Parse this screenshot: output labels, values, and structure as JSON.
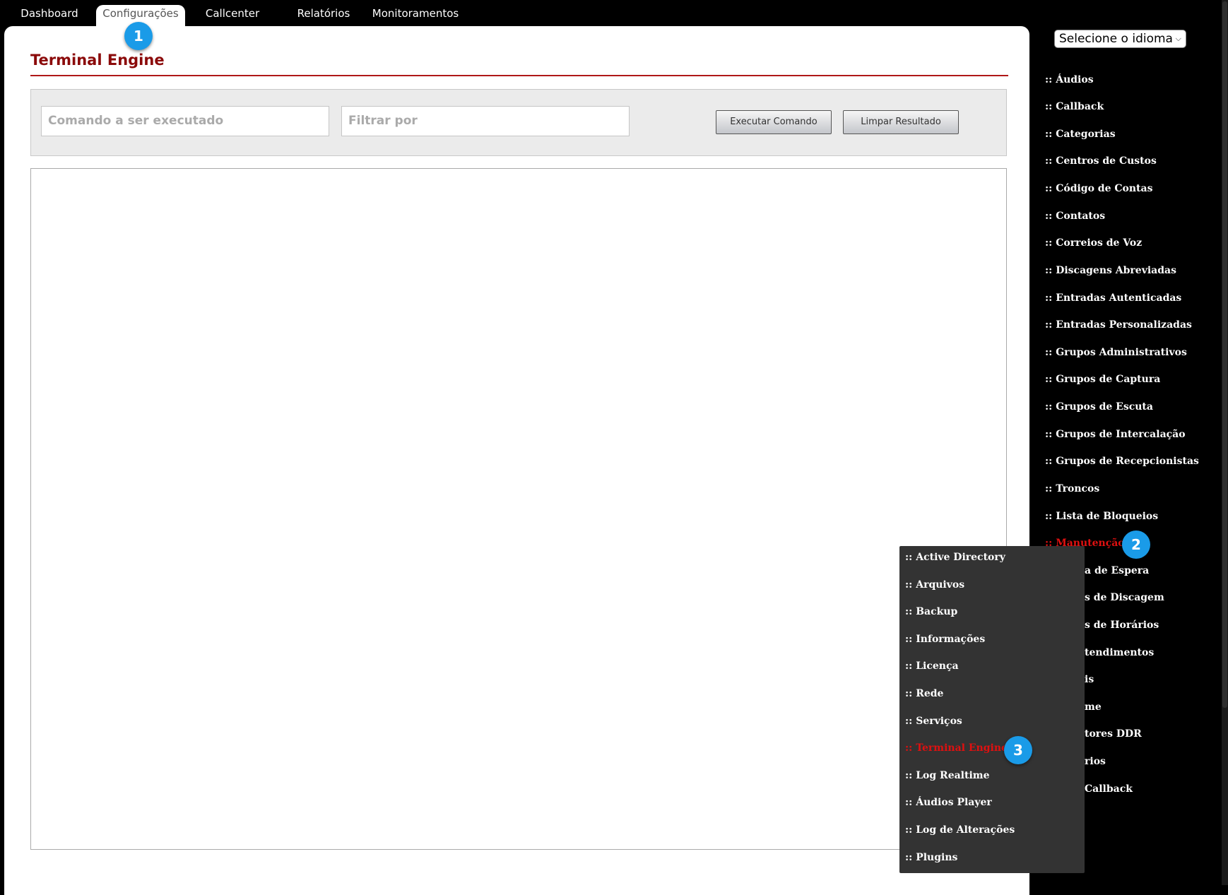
{
  "topnav": {
    "tabs": [
      {
        "label": "Dashboard"
      },
      {
        "label": "Configurações"
      },
      {
        "label": "Callcenter"
      },
      {
        "label": "Relatórios"
      },
      {
        "label": "Monitoramentos"
      }
    ]
  },
  "badges": [
    "1",
    "2",
    "3"
  ],
  "main": {
    "title": "Terminal Engine",
    "command_placeholder": "Comando a ser executado",
    "filter_placeholder": "Filtrar por",
    "execute_label": "Executar Comando",
    "clear_label": "Limpar Resultado"
  },
  "sidebar": {
    "language_select": "Selecione o idioma",
    "items": [
      {
        "label": ":: Áudios"
      },
      {
        "label": ":: Callback"
      },
      {
        "label": ":: Categorias"
      },
      {
        "label": ":: Centros de Custos"
      },
      {
        "label": ":: Código de Contas"
      },
      {
        "label": ":: Contatos"
      },
      {
        "label": ":: Correios de Voz"
      },
      {
        "label": ":: Discagens Abreviadas"
      },
      {
        "label": ":: Entradas Autenticadas"
      },
      {
        "label": ":: Entradas Personalizadas"
      },
      {
        "label": ":: Grupos Administrativos"
      },
      {
        "label": ":: Grupos de Captura"
      },
      {
        "label": ":: Grupos de Escuta"
      },
      {
        "label": ":: Grupos de Intercalação"
      },
      {
        "label": ":: Grupos de Recepcionistas"
      },
      {
        "label": ":: Troncos"
      },
      {
        "label": ":: Lista de Bloqueios"
      },
      {
        "label": ":: Manutenção"
      },
      {
        "label": "a de Espera"
      },
      {
        "label": "s de Discagem"
      },
      {
        "label": "s de Horários"
      },
      {
        "label": "tendimentos"
      },
      {
        "label": "is"
      },
      {
        "label": "me"
      },
      {
        "label": "tores DDR"
      },
      {
        "label": "rios"
      },
      {
        "label": "Callback"
      }
    ]
  },
  "submenu": {
    "items": [
      {
        "label": ":: Active Directory"
      },
      {
        "label": ":: Arquivos"
      },
      {
        "label": ":: Backup"
      },
      {
        "label": ":: Informações"
      },
      {
        "label": ":: Licença"
      },
      {
        "label": ":: Rede"
      },
      {
        "label": ":: Serviços"
      },
      {
        "label": ":: Terminal Engine"
      },
      {
        "label": ":: Log Realtime"
      },
      {
        "label": ":: Áudios Player"
      },
      {
        "label": ":: Log de Alterações"
      },
      {
        "label": ":: Plugins"
      }
    ]
  },
  "colors": {
    "active_menu": "#e01010",
    "title": "#8b0a0a",
    "badge": "#1a9be8"
  }
}
